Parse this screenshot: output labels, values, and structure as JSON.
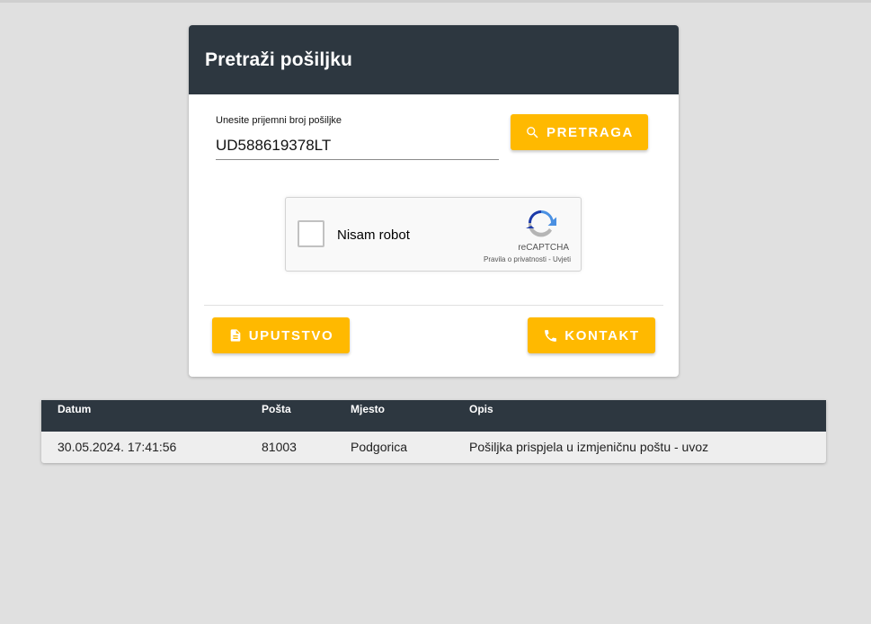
{
  "search_card": {
    "title": "Pretraži pošiljku",
    "field_label": "Unesite prijemni broj pošiljke",
    "tracking_number": "UD588619378LT",
    "search_button": "PRETRAGA",
    "guide_button": "UPUTSTVO",
    "contact_button": "KONTAKT",
    "accent_color": "#ffb900",
    "header_color": "#2d3740"
  },
  "captcha": {
    "label": "Nisam robot",
    "brand": "reCAPTCHA",
    "privacy_link": "Pravila o privatnosti",
    "separator": "-",
    "terms_link": "Uvjeti",
    "icon": "recaptcha-logo"
  },
  "results_table": {
    "headers": [
      "Datum",
      "Pošta",
      "Mjesto",
      "Opis"
    ],
    "rows": [
      [
        "30.05.2024. 17:41:56",
        "81003",
        "Podgorica",
        "Pošiljka prispjela u izmjeničnu poštu - uvoz"
      ]
    ]
  },
  "icons": {
    "search": "search-icon",
    "guide": "document-icon",
    "contact": "phone-icon"
  }
}
